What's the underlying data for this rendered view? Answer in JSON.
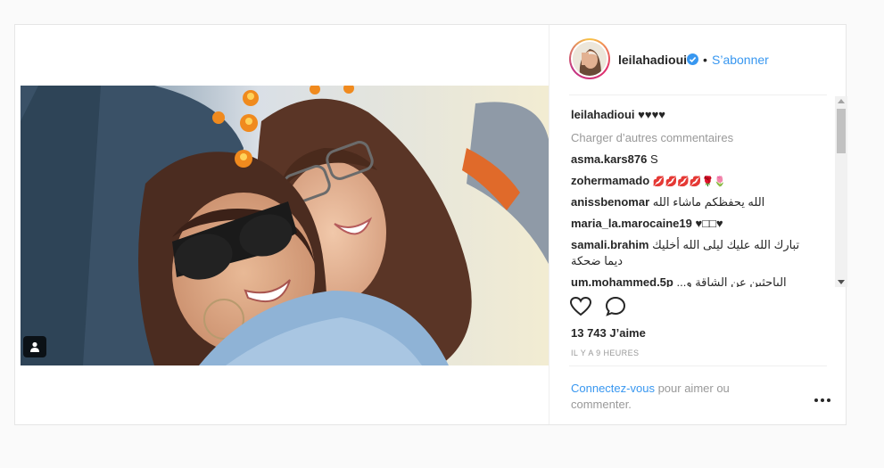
{
  "post": {
    "username": "leilahadioui",
    "separator": "•",
    "follow_label": "S’abonner",
    "caption_user": "leilahadioui",
    "caption_text": "♥♥♥♥",
    "load_more": "Charger d’autres commentaires",
    "comments": [
      {
        "user": "asma.kars876",
        "text": "S"
      },
      {
        "user": "zohermamado",
        "text": "💋💋💋💋🌹🌷"
      },
      {
        "user": "anissbenomar",
        "text": "الله يحفظكم ماشاء الله"
      },
      {
        "user": "maria_la.marocaine19",
        "text": "♥□□♥"
      },
      {
        "user": "samali.brahim",
        "text": "تبارك الله عليك ليلى الله أخليك ديما ضحكة"
      },
      {
        "user": "um.mohammed.5p",
        "text": "الباحثين عن الشاقة و..."
      }
    ],
    "likes": "13 743 J’aime",
    "timestamp": "IL Y A 9 HEURES",
    "login_link": "Connectez-vous",
    "login_rest": " pour aimer ou commenter.",
    "icons": {
      "like": "heart-icon",
      "comment": "comment-icon",
      "verified": "verified-badge-icon",
      "tag": "user-tag-icon",
      "more": "more-options-icon"
    },
    "colors": {
      "link": "#3897f0",
      "muted": "#999999",
      "text": "#262626"
    }
  }
}
